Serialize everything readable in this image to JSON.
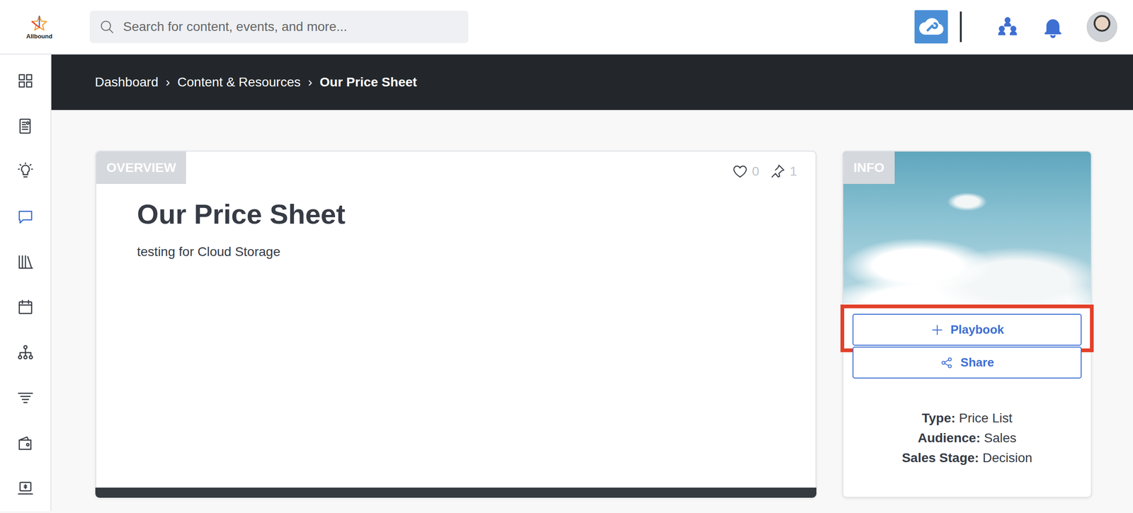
{
  "logo": {
    "text": "Allbound"
  },
  "search": {
    "placeholder": "Search for content, events, and more..."
  },
  "sidebar": {
    "items": [
      {
        "selected": false
      },
      {
        "selected": false
      },
      {
        "selected": false
      },
      {
        "selected": true
      },
      {
        "selected": false
      },
      {
        "selected": false
      },
      {
        "selected": false
      },
      {
        "selected": false
      },
      {
        "selected": false
      },
      {
        "selected": false
      }
    ]
  },
  "breadcrumb": {
    "separator": "›",
    "items": [
      {
        "label": "Dashboard",
        "selected": false
      },
      {
        "label": "Content & Resources",
        "selected": false
      },
      {
        "label": "Our Price Sheet",
        "selected": true
      }
    ]
  },
  "overview": {
    "label": "OVERVIEW",
    "likes": "0",
    "pins": "1",
    "title": "Our Price Sheet",
    "description": "testing for Cloud Storage"
  },
  "info": {
    "label": "INFO",
    "buttons": [
      {
        "label": "Playbook",
        "kind": "add",
        "highlighted": true
      },
      {
        "label": "Share",
        "kind": "share",
        "highlighted": false
      }
    ],
    "meta": [
      {
        "label": "Type:",
        "value": "Price List"
      },
      {
        "label": "Audience:",
        "value": "Sales"
      },
      {
        "label": "Sales Stage:",
        "value": "Decision"
      }
    ]
  }
}
